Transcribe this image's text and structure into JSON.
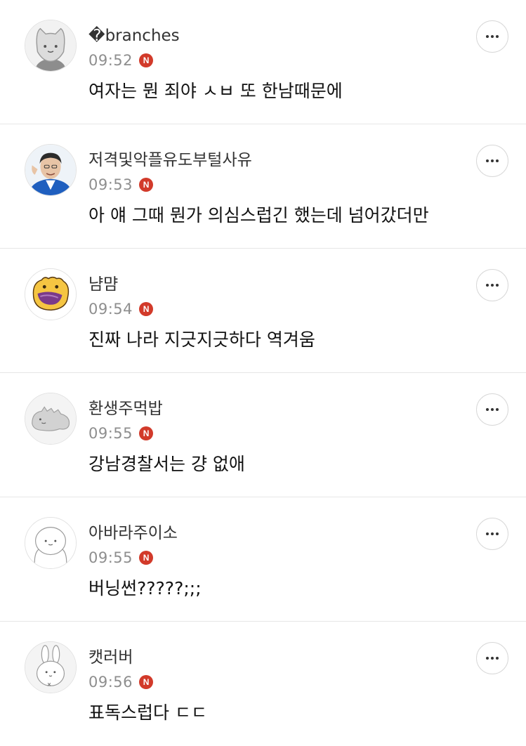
{
  "comments": [
    {
      "nickname": "�branches",
      "time": "09:52",
      "badge": "N",
      "text": "여자는 뭔 죄야 ㅅㅂ 또 한남때문에",
      "avatar": "gray-cat"
    },
    {
      "nickname": "저격및악플유도부털사유",
      "time": "09:53",
      "badge": "N",
      "text": "아 얘 그때 뭔가 의심스럽긴 했는데 넘어갔더만",
      "avatar": "man-photo"
    },
    {
      "nickname": "냠먐",
      "time": "09:54",
      "badge": "N",
      "text": "진짜 나라 지긋지긋하다 역겨움",
      "avatar": "yellow-creature"
    },
    {
      "nickname": "환생주먹밥",
      "time": "09:55",
      "badge": "N",
      "text": "강남경찰서는 걍 없애",
      "avatar": "dinosaur"
    },
    {
      "nickname": "아바라주이소",
      "time": "09:55",
      "badge": "N",
      "text": "버닝썬?????;;;",
      "avatar": "blob-character"
    },
    {
      "nickname": "캣러버",
      "time": "09:56",
      "badge": "N",
      "text": "표독스럽다 ㄷㄷ",
      "avatar": "rabbit"
    }
  ],
  "colors": {
    "badge": "#d23a2a",
    "divider": "#e6e6e6",
    "time": "#8e8e8e"
  }
}
